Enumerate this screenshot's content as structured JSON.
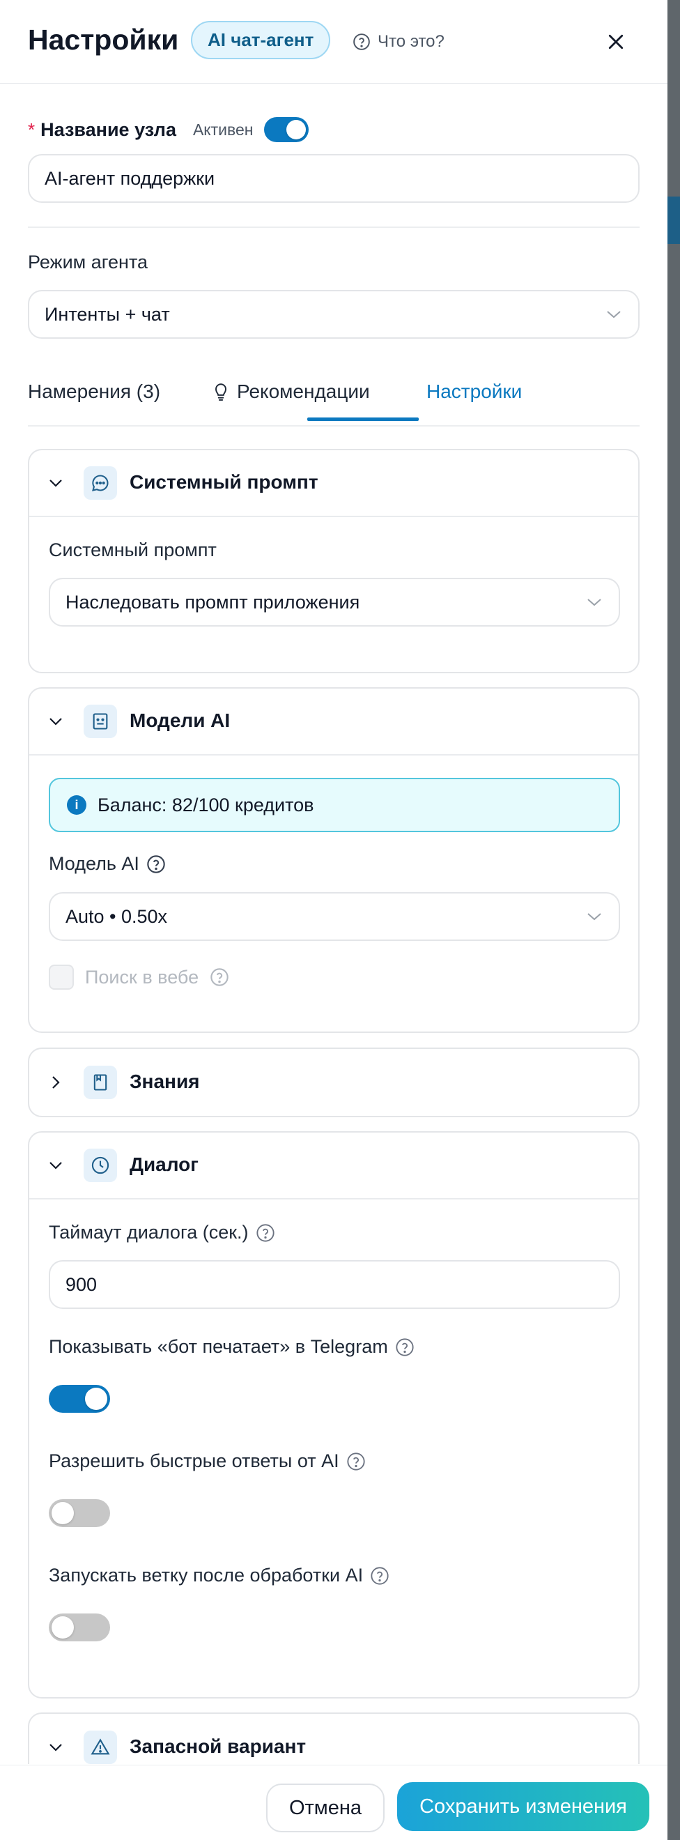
{
  "header": {
    "title": "Настройки",
    "tag": "AI чат-агент",
    "help_label": "Что это?"
  },
  "node": {
    "required_mark": "*",
    "name_label": "Название узла",
    "active_label": "Активен",
    "active": true,
    "name_value": "AI-агент поддержки"
  },
  "agent_mode": {
    "label": "Режим агента",
    "value": "Интенты + чат"
  },
  "tabs": [
    {
      "label": "Намерения (3)",
      "active": false
    },
    {
      "label": "Рекомендации",
      "active": false
    },
    {
      "label": "Настройки",
      "active": true
    }
  ],
  "system_prompt": {
    "title": "Системный промпт",
    "field_label": "Системный промпт",
    "value": "Наследовать промпт приложения"
  },
  "models": {
    "title": "Модели AI",
    "balance": "Баланс: 82/100 кредитов",
    "model_label": "Модель AI",
    "model_value": "Auto • 0.50x",
    "web_search_label": "Поиск в вебе",
    "web_search_enabled": false
  },
  "knowledge": {
    "title": "Знания"
  },
  "dialog": {
    "title": "Диалог",
    "timeout_label": "Таймаут диалога (сек.)",
    "timeout_value": "900",
    "typing_label": "Показывать «бот печатает» в Telegram",
    "typing_on": true,
    "quick_replies_label": "Разрешить быстрые ответы от AI",
    "quick_replies_on": false,
    "branch_label": "Запускать ветку после обработки AI",
    "branch_on": false
  },
  "fallback": {
    "title": "Запасной вариант"
  },
  "footer": {
    "cancel_label": "Отмена",
    "save_label": "Сохранить изменения"
  },
  "colors": {
    "accent": "#0b79c0",
    "save_gradient_start": "#1ba3d8",
    "save_gradient_end": "#25c1b7",
    "info_border": "#53c6dd",
    "info_bg": "#e6fbfd",
    "required": "#e11d48"
  },
  "icons": {
    "help": "question-circle-icon",
    "close": "close-icon",
    "recommendations": "lightbulb-icon",
    "system_prompt": "chat-bubble-icon",
    "models": "robot-icon",
    "knowledge": "book-icon",
    "dialog": "clock-icon",
    "fallback": "warning-triangle-icon",
    "info": "info-icon"
  }
}
